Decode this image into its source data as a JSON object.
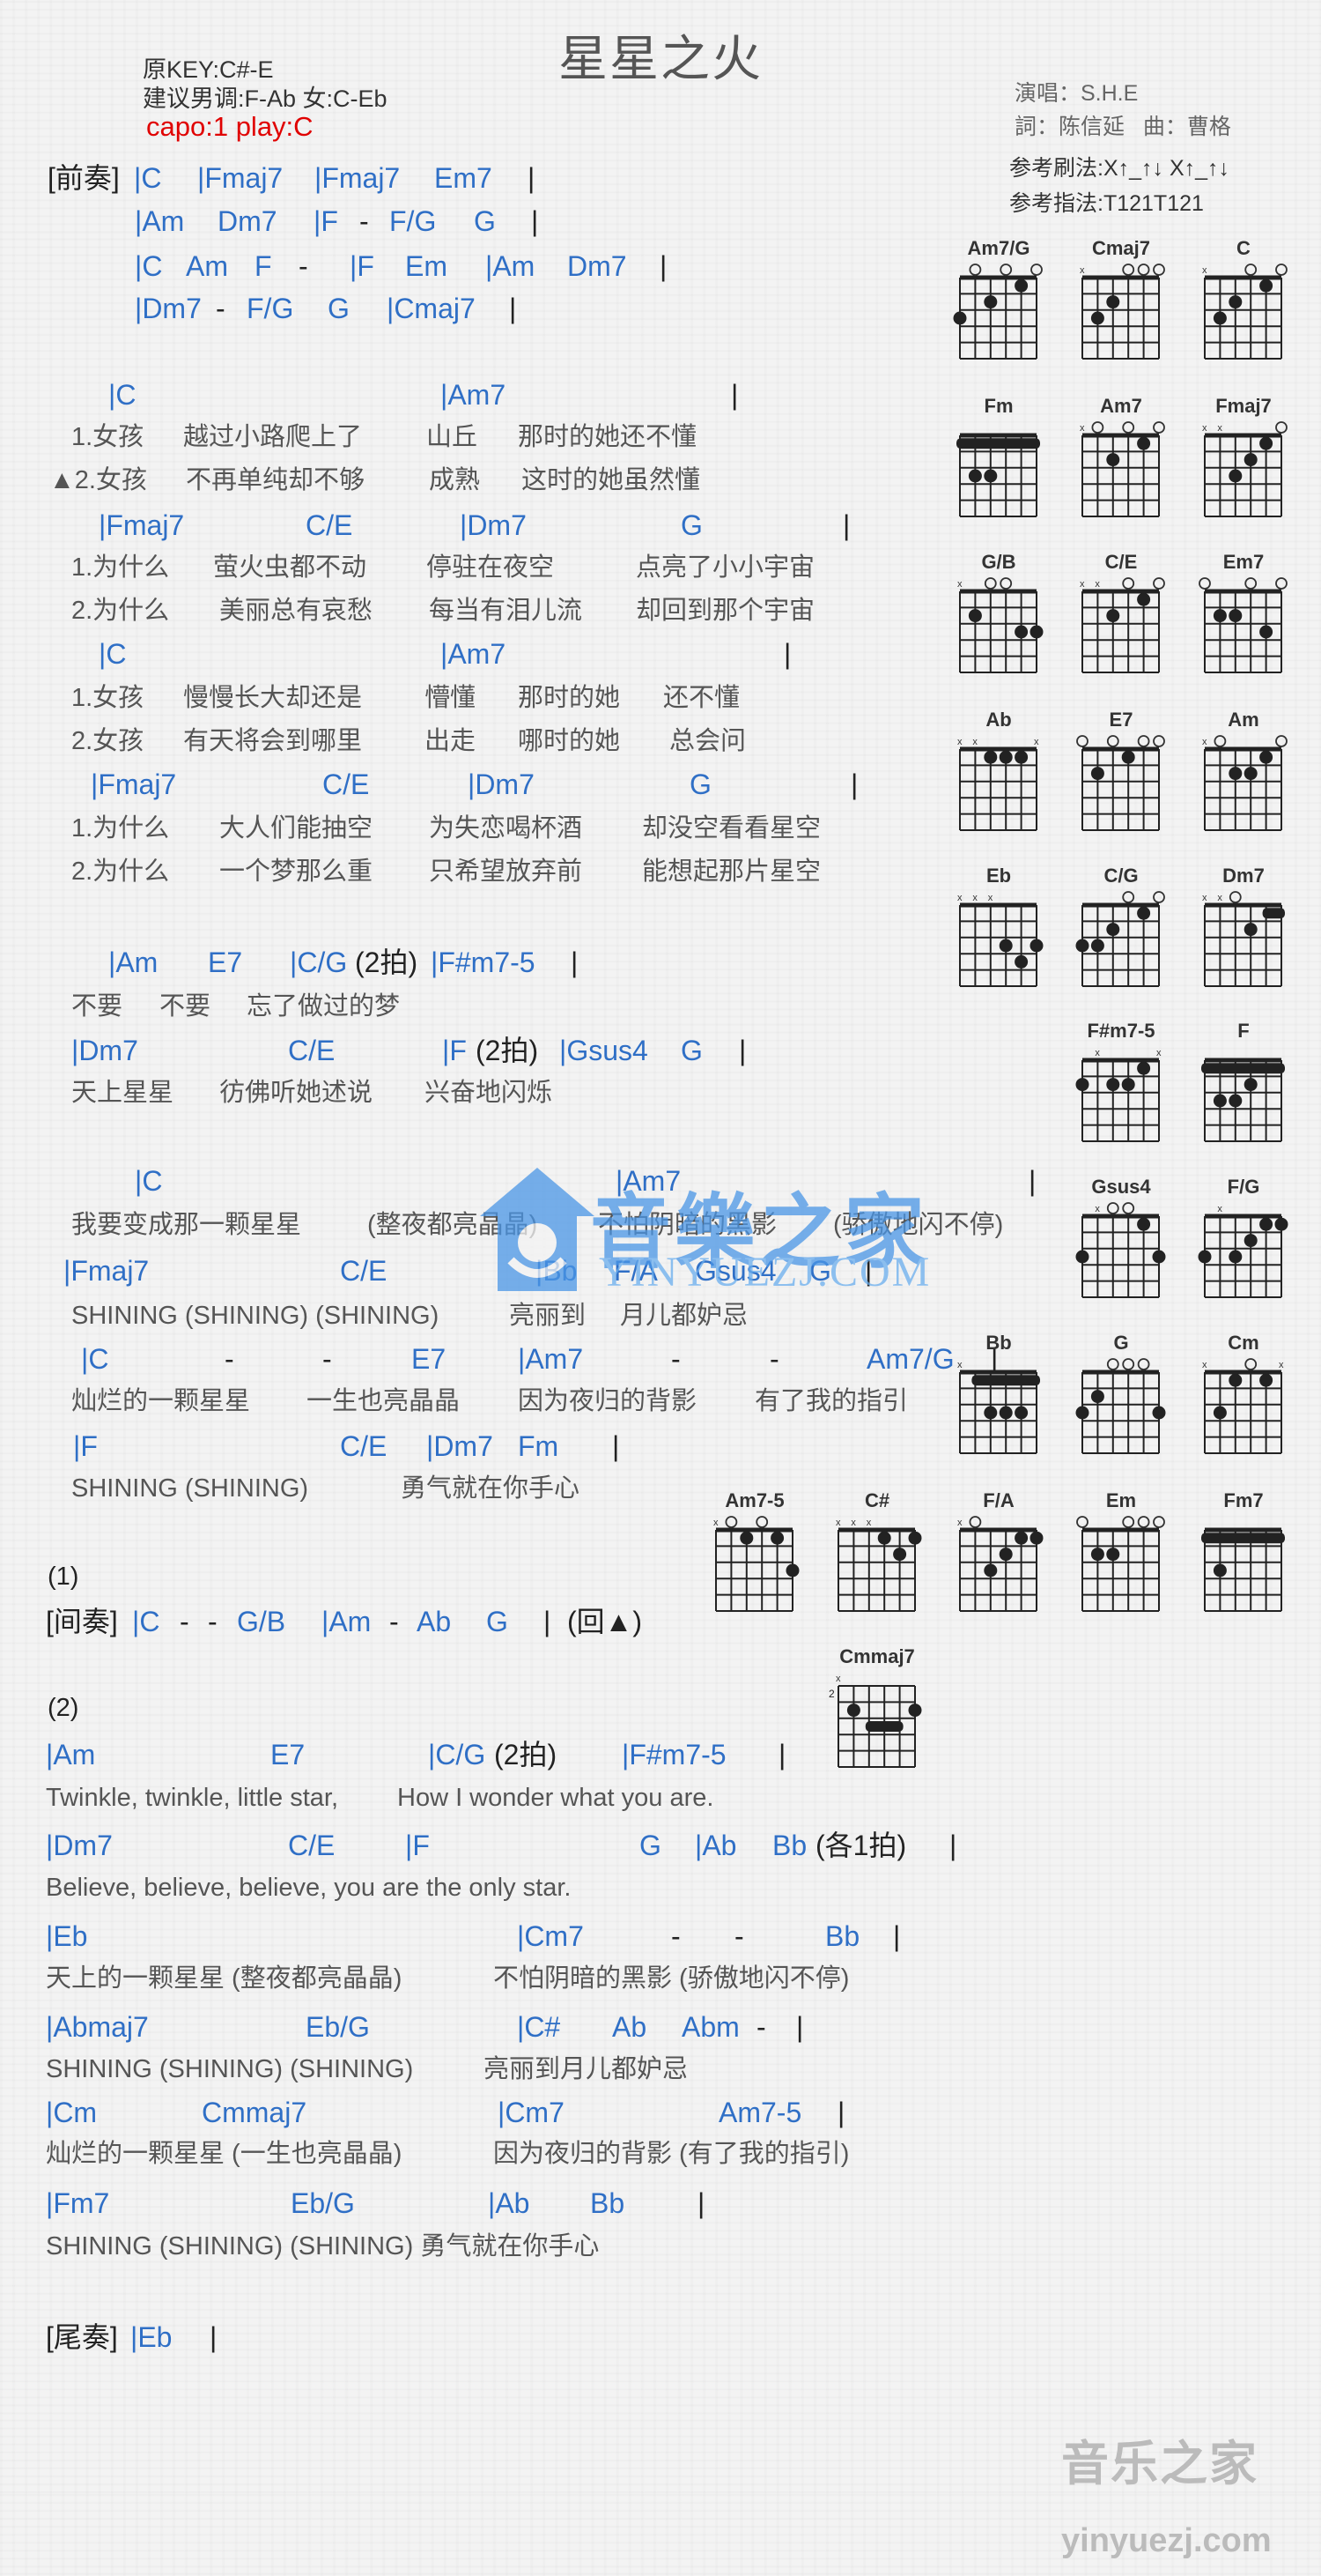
{
  "header": {
    "title": "星星之火",
    "original_key": "原KEY:C#-E",
    "suggested_key": "建议男调:F-Ab 女:C-Eb",
    "capo": "capo:1 play:C",
    "singer": "演唱：S.H.E",
    "credits": "詞：陈信延   曲：曹格",
    "strum": "参考刷法:X↑_↑↓ X↑_↑↓",
    "finger": "参考指法:T121T121"
  },
  "colors": {
    "chord": "#2f6fc6",
    "lyric": "#555555",
    "capo": "#e00000"
  },
  "lines": [
    {
      "type": "chord",
      "tokens": [
        "[前奏]",
        "|C",
        "|Fmaj7",
        "|Fmaj7",
        "Em7",
        "|"
      ]
    },
    {
      "type": "chord",
      "tokens": [
        "|Am",
        "Dm7",
        "|F",
        "-",
        "F/G",
        "G",
        "|"
      ]
    },
    {
      "type": "chord",
      "tokens": [
        "|C",
        "Am",
        "F",
        "-",
        "|F",
        "Em",
        "|Am",
        "Dm7",
        "|"
      ]
    },
    {
      "type": "chord",
      "tokens": [
        "|Dm7",
        "-",
        "F/G",
        "G",
        "|Cmaj7",
        "|"
      ]
    },
    {
      "type": "chord",
      "tokens": [
        "|C",
        "|Am7",
        "|"
      ]
    },
    {
      "type": "lyric",
      "tokens": [
        "1.女孩",
        "越过小路爬上了",
        "山丘",
        "那时的她还不懂"
      ]
    },
    {
      "type": "lyric",
      "tokens": [
        "▲2.女孩",
        "不再单纯却不够",
        "成熟",
        "这时的她虽然懂"
      ]
    },
    {
      "type": "chord",
      "tokens": [
        "|Fmaj7",
        "C/E",
        "|Dm7",
        "G",
        "|"
      ]
    },
    {
      "type": "lyric",
      "tokens": [
        "1.为什么",
        "萤火虫都不动",
        "停驻在夜空",
        "点亮了小小宇宙"
      ]
    },
    {
      "type": "lyric",
      "tokens": [
        "2.为什么",
        "美丽总有哀愁",
        "每当有泪儿流",
        "却回到那个宇宙"
      ]
    },
    {
      "type": "chord",
      "tokens": [
        "|C",
        "|Am7",
        "|"
      ]
    },
    {
      "type": "lyric",
      "tokens": [
        "1.女孩",
        "慢慢长大却还是",
        "懵懂",
        "那时的她",
        "还不懂"
      ]
    },
    {
      "type": "lyric",
      "tokens": [
        "2.女孩",
        "有天将会到哪里",
        "出走",
        "哪时的她",
        "总会问"
      ]
    },
    {
      "type": "chord",
      "tokens": [
        "|Fmaj7",
        "C/E",
        "|Dm7",
        "G",
        "|"
      ]
    },
    {
      "type": "lyric",
      "tokens": [
        "1.为什么",
        "大人们能抽空",
        "为失恋喝杯酒",
        "却没空看看星空"
      ]
    },
    {
      "type": "lyric",
      "tokens": [
        "2.为什么",
        "一个梦那么重",
        "只希望放弃前",
        "能想起那片星空"
      ]
    },
    {
      "type": "chord",
      "tokens": [
        "|Am",
        "E7",
        "|C/G",
        "(2拍)",
        "|F#m7-5",
        "|"
      ]
    },
    {
      "type": "lyric",
      "tokens": [
        "不要",
        "不要",
        "忘了做过的梦"
      ]
    },
    {
      "type": "chord",
      "tokens": [
        "|Dm7",
        "C/E",
        "|F",
        "(2拍)",
        "|Gsus4",
        "G",
        "|"
      ]
    },
    {
      "type": "lyric",
      "tokens": [
        "天上星星",
        "彷佛听她述说",
        "兴奋地闪烁"
      ]
    },
    {
      "type": "chord",
      "tokens": [
        "|C",
        "|Am7",
        "|"
      ]
    },
    {
      "type": "lyric",
      "tokens": [
        "我要变成那一颗星星",
        "(整夜都亮晶晶)",
        "不怕阴暗的黑影",
        "(骄傲地闪不停)"
      ]
    },
    {
      "type": "chord",
      "tokens": [
        "|Fmaj7",
        "C/E",
        "|Bb",
        "F/A",
        "Gsus4",
        "G",
        "|"
      ]
    },
    {
      "type": "lyric",
      "tokens": [
        "SHINING (SHINING) (SHINING)",
        "亮丽到",
        "月儿都妒忌"
      ]
    },
    {
      "type": "chord",
      "tokens": [
        "|C",
        "-",
        "-",
        "E7",
        "|Am7",
        "-",
        "-",
        "Am7/G",
        "|"
      ]
    },
    {
      "type": "lyric",
      "tokens": [
        "灿烂的一颗星星",
        "一生也亮晶晶",
        "因为夜归的背影",
        "有了我的指引"
      ]
    },
    {
      "type": "chord",
      "tokens": [
        "|F",
        "C/E",
        "|Dm7",
        "Fm",
        "|"
      ]
    },
    {
      "type": "lyric",
      "tokens": [
        "SHINING (SHINING)",
        "勇气就在你手心"
      ]
    },
    {
      "type": "lyric",
      "tokens": [
        "(1)"
      ]
    },
    {
      "type": "chord",
      "tokens": [
        "[间奏]",
        "|C",
        "-",
        "-",
        "G/B",
        "|Am",
        "-",
        "Ab",
        "G",
        "|",
        "(回▲)"
      ]
    },
    {
      "type": "lyric",
      "tokens": [
        "(2)"
      ]
    },
    {
      "type": "chord",
      "tokens": [
        "|Am",
        "E7",
        "|C/G",
        "(2拍)",
        "|F#m7-5",
        "|"
      ]
    },
    {
      "type": "lyric",
      "tokens": [
        "Twinkle, twinkle, little star,",
        "How I wonder what you are."
      ]
    },
    {
      "type": "chord",
      "tokens": [
        "|Dm7",
        "C/E",
        "|F",
        "G",
        "|Ab",
        "Bb",
        "(各1拍)",
        "|"
      ]
    },
    {
      "type": "lyric",
      "tokens": [
        "Believe, believe, believe, you are the only star."
      ]
    },
    {
      "type": "chord",
      "tokens": [
        "|Eb",
        "|Cm7",
        "-",
        "-",
        "Bb",
        "|"
      ]
    },
    {
      "type": "lyric",
      "tokens": [
        "天上的一颗星星 (整夜都亮晶晶)",
        "不怕阴暗的黑影 (骄傲地闪不停)"
      ]
    },
    {
      "type": "chord",
      "tokens": [
        "|Abmaj7",
        "Eb/G",
        "|C#",
        "Ab",
        "Abm",
        "-",
        "|"
      ]
    },
    {
      "type": "lyric",
      "tokens": [
        "SHINING (SHINING) (SHINING)",
        "亮丽到月儿都妒忌"
      ]
    },
    {
      "type": "chord",
      "tokens": [
        "|Cm",
        "Cmmaj7",
        "|Cm7",
        "Am7-5",
        "|"
      ]
    },
    {
      "type": "lyric",
      "tokens": [
        "灿烂的一颗星星 (一生也亮晶晶)",
        "因为夜归的背影 (有了我的指引)"
      ]
    },
    {
      "type": "chord",
      "tokens": [
        "|Fm7",
        "Eb/G",
        "|Ab",
        "Bb",
        "|"
      ]
    },
    {
      "type": "lyric",
      "tokens": [
        "SHINING (SHINING) (SHINING) 勇气就在你手心"
      ]
    },
    {
      "type": "chord",
      "tokens": [
        "[尾奏]",
        "|Eb",
        "|"
      ]
    }
  ],
  "chord_diagrams": [
    {
      "name": "Am7/G",
      "frets": [
        3,
        0,
        2,
        0,
        1,
        0
      ]
    },
    {
      "name": "Cmaj7",
      "frets": [
        -1,
        3,
        2,
        0,
        0,
        0
      ]
    },
    {
      "name": "C",
      "frets": [
        -1,
        3,
        2,
        0,
        1,
        0
      ]
    },
    {
      "name": "Fm",
      "frets": [
        1,
        3,
        3,
        1,
        1,
        1
      ],
      "barre": 1
    },
    {
      "name": "Am7",
      "frets": [
        -1,
        0,
        2,
        0,
        1,
        0
      ]
    },
    {
      "name": "Fmaj7",
      "frets": [
        -1,
        -1,
        3,
        2,
        1,
        0
      ]
    },
    {
      "name": "G/B",
      "frets": [
        -1,
        2,
        0,
        0,
        3,
        3
      ]
    },
    {
      "name": "C/E",
      "frets": [
        -1,
        -1,
        2,
        0,
        1,
        0
      ]
    },
    {
      "name": "Em7",
      "frets": [
        0,
        2,
        2,
        0,
        3,
        0
      ]
    },
    {
      "name": "Ab",
      "frets": [
        -1,
        -1,
        1,
        1,
        1,
        -1
      ]
    },
    {
      "name": "E7",
      "frets": [
        0,
        2,
        0,
        1,
        0,
        0
      ]
    },
    {
      "name": "Am",
      "frets": [
        -1,
        0,
        2,
        2,
        1,
        0
      ]
    },
    {
      "name": "Eb",
      "frets": [
        -1,
        -1,
        -1,
        3,
        4,
        3
      ]
    },
    {
      "name": "C/G",
      "frets": [
        3,
        3,
        2,
        0,
        1,
        0
      ]
    },
    {
      "name": "Dm7",
      "frets": [
        -1,
        -1,
        0,
        2,
        1,
        1
      ],
      "barre": 1
    },
    {
      "name": "F#m7-5",
      "frets": [
        2,
        -1,
        2,
        2,
        1,
        -1
      ]
    },
    {
      "name": "F",
      "frets": [
        1,
        3,
        3,
        2,
        1,
        1
      ],
      "barre": 1
    },
    {
      "name": "Gsus4",
      "frets": [
        3,
        -1,
        0,
        0,
        1,
        3
      ]
    },
    {
      "name": "F/G",
      "frets": [
        3,
        -1,
        3,
        2,
        1,
        1
      ]
    },
    {
      "name": "Bb",
      "frets": [
        -1,
        1,
        3,
        3,
        3,
        1
      ],
      "barre": 1
    },
    {
      "name": "G",
      "frets": [
        3,
        2,
        0,
        0,
        0,
        3
      ]
    },
    {
      "name": "Cm",
      "frets": [
        -1,
        3,
        1,
        0,
        1,
        -1
      ]
    },
    {
      "name": "Am7-5",
      "frets": [
        -1,
        0,
        1,
        0,
        1,
        3
      ]
    },
    {
      "name": "C#",
      "frets": [
        -1,
        -1,
        -1,
        1,
        2,
        1
      ]
    },
    {
      "name": "F/A",
      "frets": [
        -1,
        0,
        3,
        2,
        1,
        1
      ]
    },
    {
      "name": "Em",
      "frets": [
        0,
        2,
        2,
        0,
        0,
        0
      ]
    },
    {
      "name": "Fm7",
      "frets": [
        1,
        3,
        1,
        1,
        1,
        1
      ],
      "barre": 1
    },
    {
      "name": "Cmmaj7",
      "frets": [
        -1,
        2,
        3,
        3,
        3,
        2
      ],
      "barre": 3,
      "base_fret": "2"
    }
  ],
  "watermark": {
    "cn": "音樂之家",
    "en": "YINYUEZJ.COM"
  },
  "footer_logo": {
    "cn": "音乐之家",
    "en": "yinyuezj.com"
  }
}
